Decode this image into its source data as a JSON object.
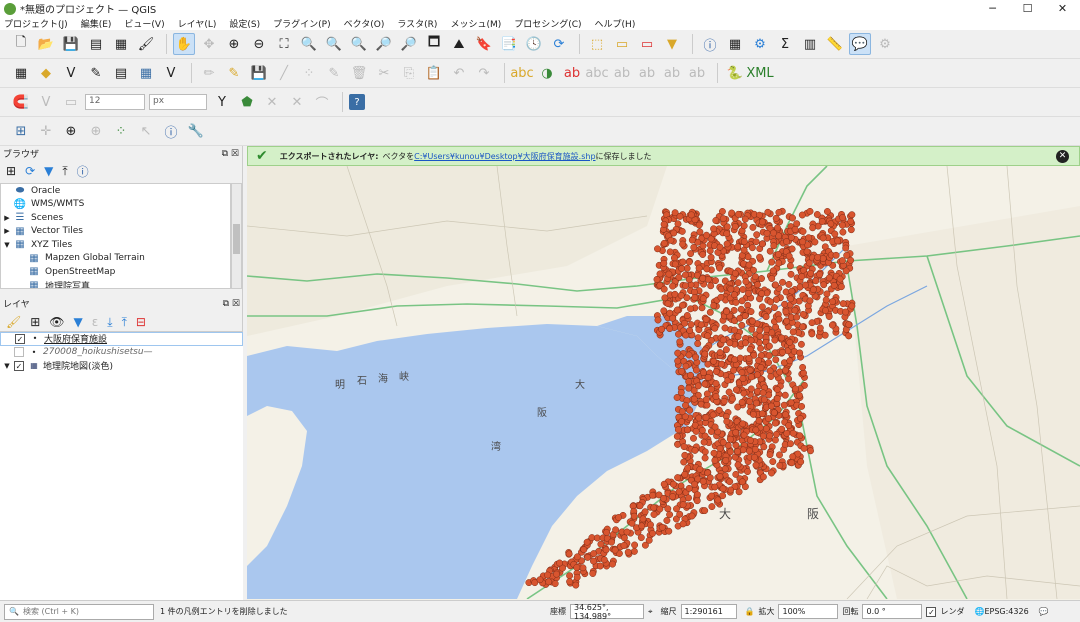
{
  "window": {
    "title": "*無題のプロジェクト — QGIS",
    "minimize": "─",
    "maximize": "☐",
    "close": "✕"
  },
  "menu": [
    "プロジェクト(J)",
    "編集(E)",
    "ビュー(V)",
    "レイヤ(L)",
    "設定(S)",
    "プラグイン(P)",
    "ベクタ(O)",
    "ラスタ(R)",
    "メッシュ(M)",
    "プロセシング(C)",
    "ヘルプ(H)"
  ],
  "digitize": {
    "size_value": "12",
    "unit": "px"
  },
  "browser_panel": {
    "title": "ブラウザ",
    "items": [
      {
        "label": "Oracle",
        "icon": "oracle-icon",
        "arrow": ""
      },
      {
        "label": "WMS/WMTS",
        "icon": "wms-icon",
        "arrow": ""
      },
      {
        "label": "Scenes",
        "icon": "scenes-icon",
        "arrow": "▶"
      },
      {
        "label": "Vector Tiles",
        "icon": "vector-tiles-icon",
        "arrow": "▶"
      },
      {
        "label": "XYZ Tiles",
        "icon": "xyz-tiles-icon",
        "arrow": "▼"
      },
      {
        "label": "Mapzen Global Terrain",
        "icon": "tile-icon",
        "arrow": "",
        "indent": true
      },
      {
        "label": "OpenStreetMap",
        "icon": "tile-icon",
        "arrow": "",
        "indent": true
      },
      {
        "label": "地理院写真",
        "icon": "tile-icon",
        "arrow": "",
        "indent": true
      }
    ]
  },
  "layers_panel": {
    "title": "レイヤ",
    "layers": [
      {
        "label": "大阪府保育施設",
        "checked": true,
        "selected": true,
        "italic": false,
        "icon": "point-layer-icon"
      },
      {
        "label": "270008_hoikushisetsu—",
        "checked": false,
        "selected": false,
        "italic": true,
        "icon": "point-layer-icon"
      },
      {
        "label": "地理院地図(淡色)",
        "checked": true,
        "selected": false,
        "italic": false,
        "icon": "raster-layer-icon",
        "expand": "▼"
      }
    ]
  },
  "message_bar": {
    "title": "エクスポートされたレイヤ:",
    "text_prefix": "ベクタを",
    "path": "C:¥Users¥kunou¥Desktop¥大阪府保育施設.shp",
    "text_suffix": "に保存しました",
    "close": "✕"
  },
  "map": {
    "labels": [
      "明",
      "石",
      "海",
      "峡",
      "大",
      "阪",
      "湾",
      "大",
      "阪"
    ],
    "point_color": "#d8552f",
    "water_color": "#aac7ee",
    "land_color": "#f4f1e7",
    "point_count_note": ""
  },
  "status": {
    "search_placeholder": "検索 (Ctrl + K)",
    "message": "1 件の凡例エントリを削除しました",
    "coord_label": "座標",
    "coord_value": "34.625°, 134.989°",
    "scale_label": "縮尺",
    "scale_value": "1:290161",
    "magnifier_label": "拡大",
    "magnifier_value": "100%",
    "rotation_label": "回転",
    "rotation_value": "0.0 °",
    "render_label": "レンダ",
    "crs": "EPSG:4326"
  }
}
